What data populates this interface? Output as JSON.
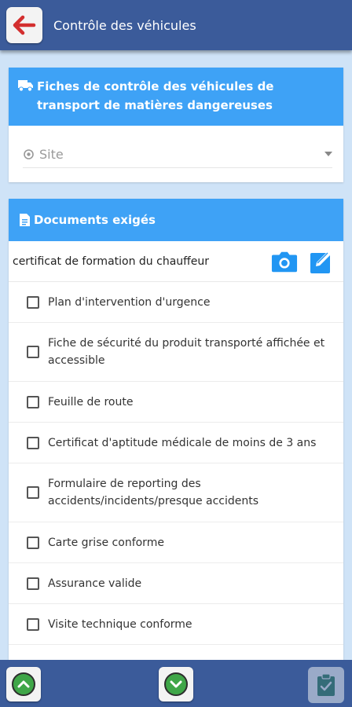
{
  "appbar": {
    "title": "Contrôle des véhicules",
    "back_icon": "arrow-left-icon"
  },
  "card_vehicle": {
    "title": "Fiches de contrôle des véhicules de transport de matières dangereuses",
    "title_icon": "truck-icon",
    "site_select": {
      "placeholder": "Site",
      "icon": "location-target-icon"
    }
  },
  "card_documents": {
    "title": "Documents exigés",
    "title_icon": "document-icon",
    "cert_label": "certificat de formation du chauffeur",
    "items": [
      {
        "label": "Plan d'intervention d'urgence",
        "checked": false
      },
      {
        "label": "Fiche de sécurité du produit transporté affichée et accessible",
        "checked": false
      },
      {
        "label": "Feuille de route",
        "checked": false
      },
      {
        "label": "Certificat d'aptitude médicale de moins de 3 ans",
        "checked": false
      },
      {
        "label": "Formulaire de reporting des accidents/incidents/presque accidents",
        "checked": false
      },
      {
        "label": "Carte grise conforme",
        "checked": false
      },
      {
        "label": "Assurance valide",
        "checked": false
      },
      {
        "label": "Visite technique conforme",
        "checked": false
      }
    ]
  },
  "colors": {
    "appbar": "#3b5b9a",
    "card_header": "#3ea2f6",
    "accent_icon": "#2196f3",
    "nav_green": "#3fa648",
    "back_arrow": "#d32f2f"
  }
}
